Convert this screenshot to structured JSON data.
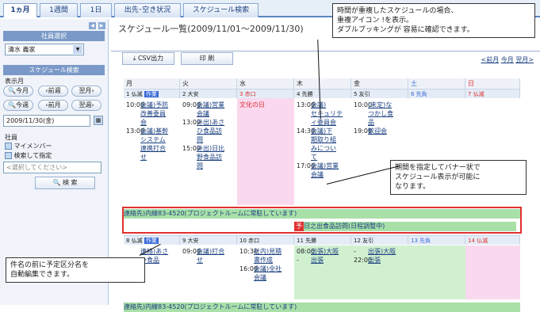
{
  "tabs": [
    "1ヵ月",
    "1週間",
    "1日",
    "出先･空き状況",
    "スケジュール検索"
  ],
  "sidebar": {
    "employee_header": "社員選択",
    "employee_value": "清水 義家",
    "search_header": "スケジュール検索",
    "display_month_label": "表示月",
    "this_month": "今月",
    "prev_week": "前週",
    "next_month": "翌月",
    "this_week": "今週",
    "prev_month": "前月",
    "next_week": "翌週",
    "date_value": "2009/11/30(金)",
    "employee_label": "社員",
    "my_member": "マイメンバー",
    "search_specify": "検索して指定",
    "select_placeholder": "<選択してください>",
    "search_button": "検 索"
  },
  "main": {
    "title": "スケジュール一覧(2009/11/01～2009/11/30)",
    "csv_button": "CSV出力",
    "print_button": "印 刷",
    "nav_prev": "<前月",
    "nav_this": "今月",
    "nav_next": "翌月>"
  },
  "calendar": {
    "dow": [
      "月",
      "火",
      "水",
      "木",
      "金",
      "土",
      "日"
    ],
    "week1_days": [
      "1 仏滅",
      "2 大安",
      "3 赤口",
      "4 先勝",
      "5 友引",
      "6 先負",
      "7 仏滅"
    ],
    "week1_tag": "作業",
    "holiday": "文化の日",
    "week2_days": [
      "8 仏滅",
      "9 大安",
      "10 赤口",
      "11 先勝",
      "12 友引",
      "13 先負",
      "14 仏滅"
    ],
    "week2_tag": "作業",
    "events": {
      "mon1": [
        [
          "10:00",
          "会議)予防"
        ],
        [
          "",
          "改善委員"
        ],
        [
          "",
          "会"
        ],
        [
          "13:00",
          "会議)基幹"
        ],
        [
          "",
          "システム"
        ],
        [
          "",
          "連携打合"
        ],
        [
          "",
          "せ"
        ]
      ],
      "tue1": [
        [
          "09:00",
          "会議)営業"
        ],
        [
          "",
          "会議"
        ],
        [
          "13:00",
          "外出)あさ"
        ],
        [
          "",
          "ひ食品訪"
        ],
        [
          "",
          "問"
        ],
        [
          "15:00",
          "外出)日比"
        ],
        [
          "",
          "野食品訪"
        ],
        [
          "",
          "問"
        ]
      ],
      "thu1": [
        [
          "13:00",
          "会議)"
        ],
        [
          "",
          "セキュリテ"
        ],
        [
          "",
          "ィ委員会"
        ],
        [
          "14:30",
          "会議)下"
        ],
        [
          "",
          "期取り組"
        ],
        [
          "",
          "みについ"
        ],
        [
          "",
          "て"
        ],
        [
          "17:00",
          "会議)営業"
        ],
        [
          "",
          "会議"
        ]
      ],
      "fri1": [
        [
          "10:00",
          "(未定)な"
        ],
        [
          "",
          "つかし食"
        ],
        [
          "",
          "品"
        ],
        [
          "19:00",
          "歓迎会"
        ]
      ],
      "mon2": [
        [
          "",
          "連絡)あさ"
        ],
        [
          "",
          "ひ食品"
        ]
      ],
      "tue2": [
        [
          "09:00",
          "会議)打合"
        ],
        [
          "",
          "せ"
        ]
      ],
      "wed2": [
        [
          "10:30",
          "社内)見積"
        ],
        [
          "",
          "書作成"
        ],
        [
          "16:00",
          "会議)全社"
        ],
        [
          "",
          "会議"
        ]
      ],
      "thu2": [
        [
          "08:00",
          "出張)大阪"
        ],
        [
          "-",
          "出張"
        ]
      ],
      "fri2": [
        [
          "-",
          "出張)大阪"
        ],
        [
          "22:00",
          "出張"
        ]
      ]
    },
    "banner1": "連絡先)内線83-4520(プロジェクトルームに常駐しています)",
    "banner2": "日之出食品訪問(日程調整中)",
    "banner3": "連絡先)内線83-4520(プロジェクトルームに常駐しています)"
  },
  "callouts": {
    "top": [
      "時間が重複したスケジュールの場合、",
      "重複アイコン !を表示。",
      "ダブルブッキングが 容易に確認できます。"
    ],
    "right": [
      "期間を指定してバナー状で",
      "スケジュール表示が可能に",
      "なります。"
    ],
    "left": [
      "件名の前に予定区分名を",
      "自動編集できます。"
    ]
  },
  "colors": {
    "tab_active_border": "#5a86c4",
    "saturday": "#3a6ad8",
    "sunday": "#e03030",
    "holiday_bg": "#fad8ee",
    "banner_bg": "#a8e0a8",
    "highlight_box": "#e03030"
  }
}
